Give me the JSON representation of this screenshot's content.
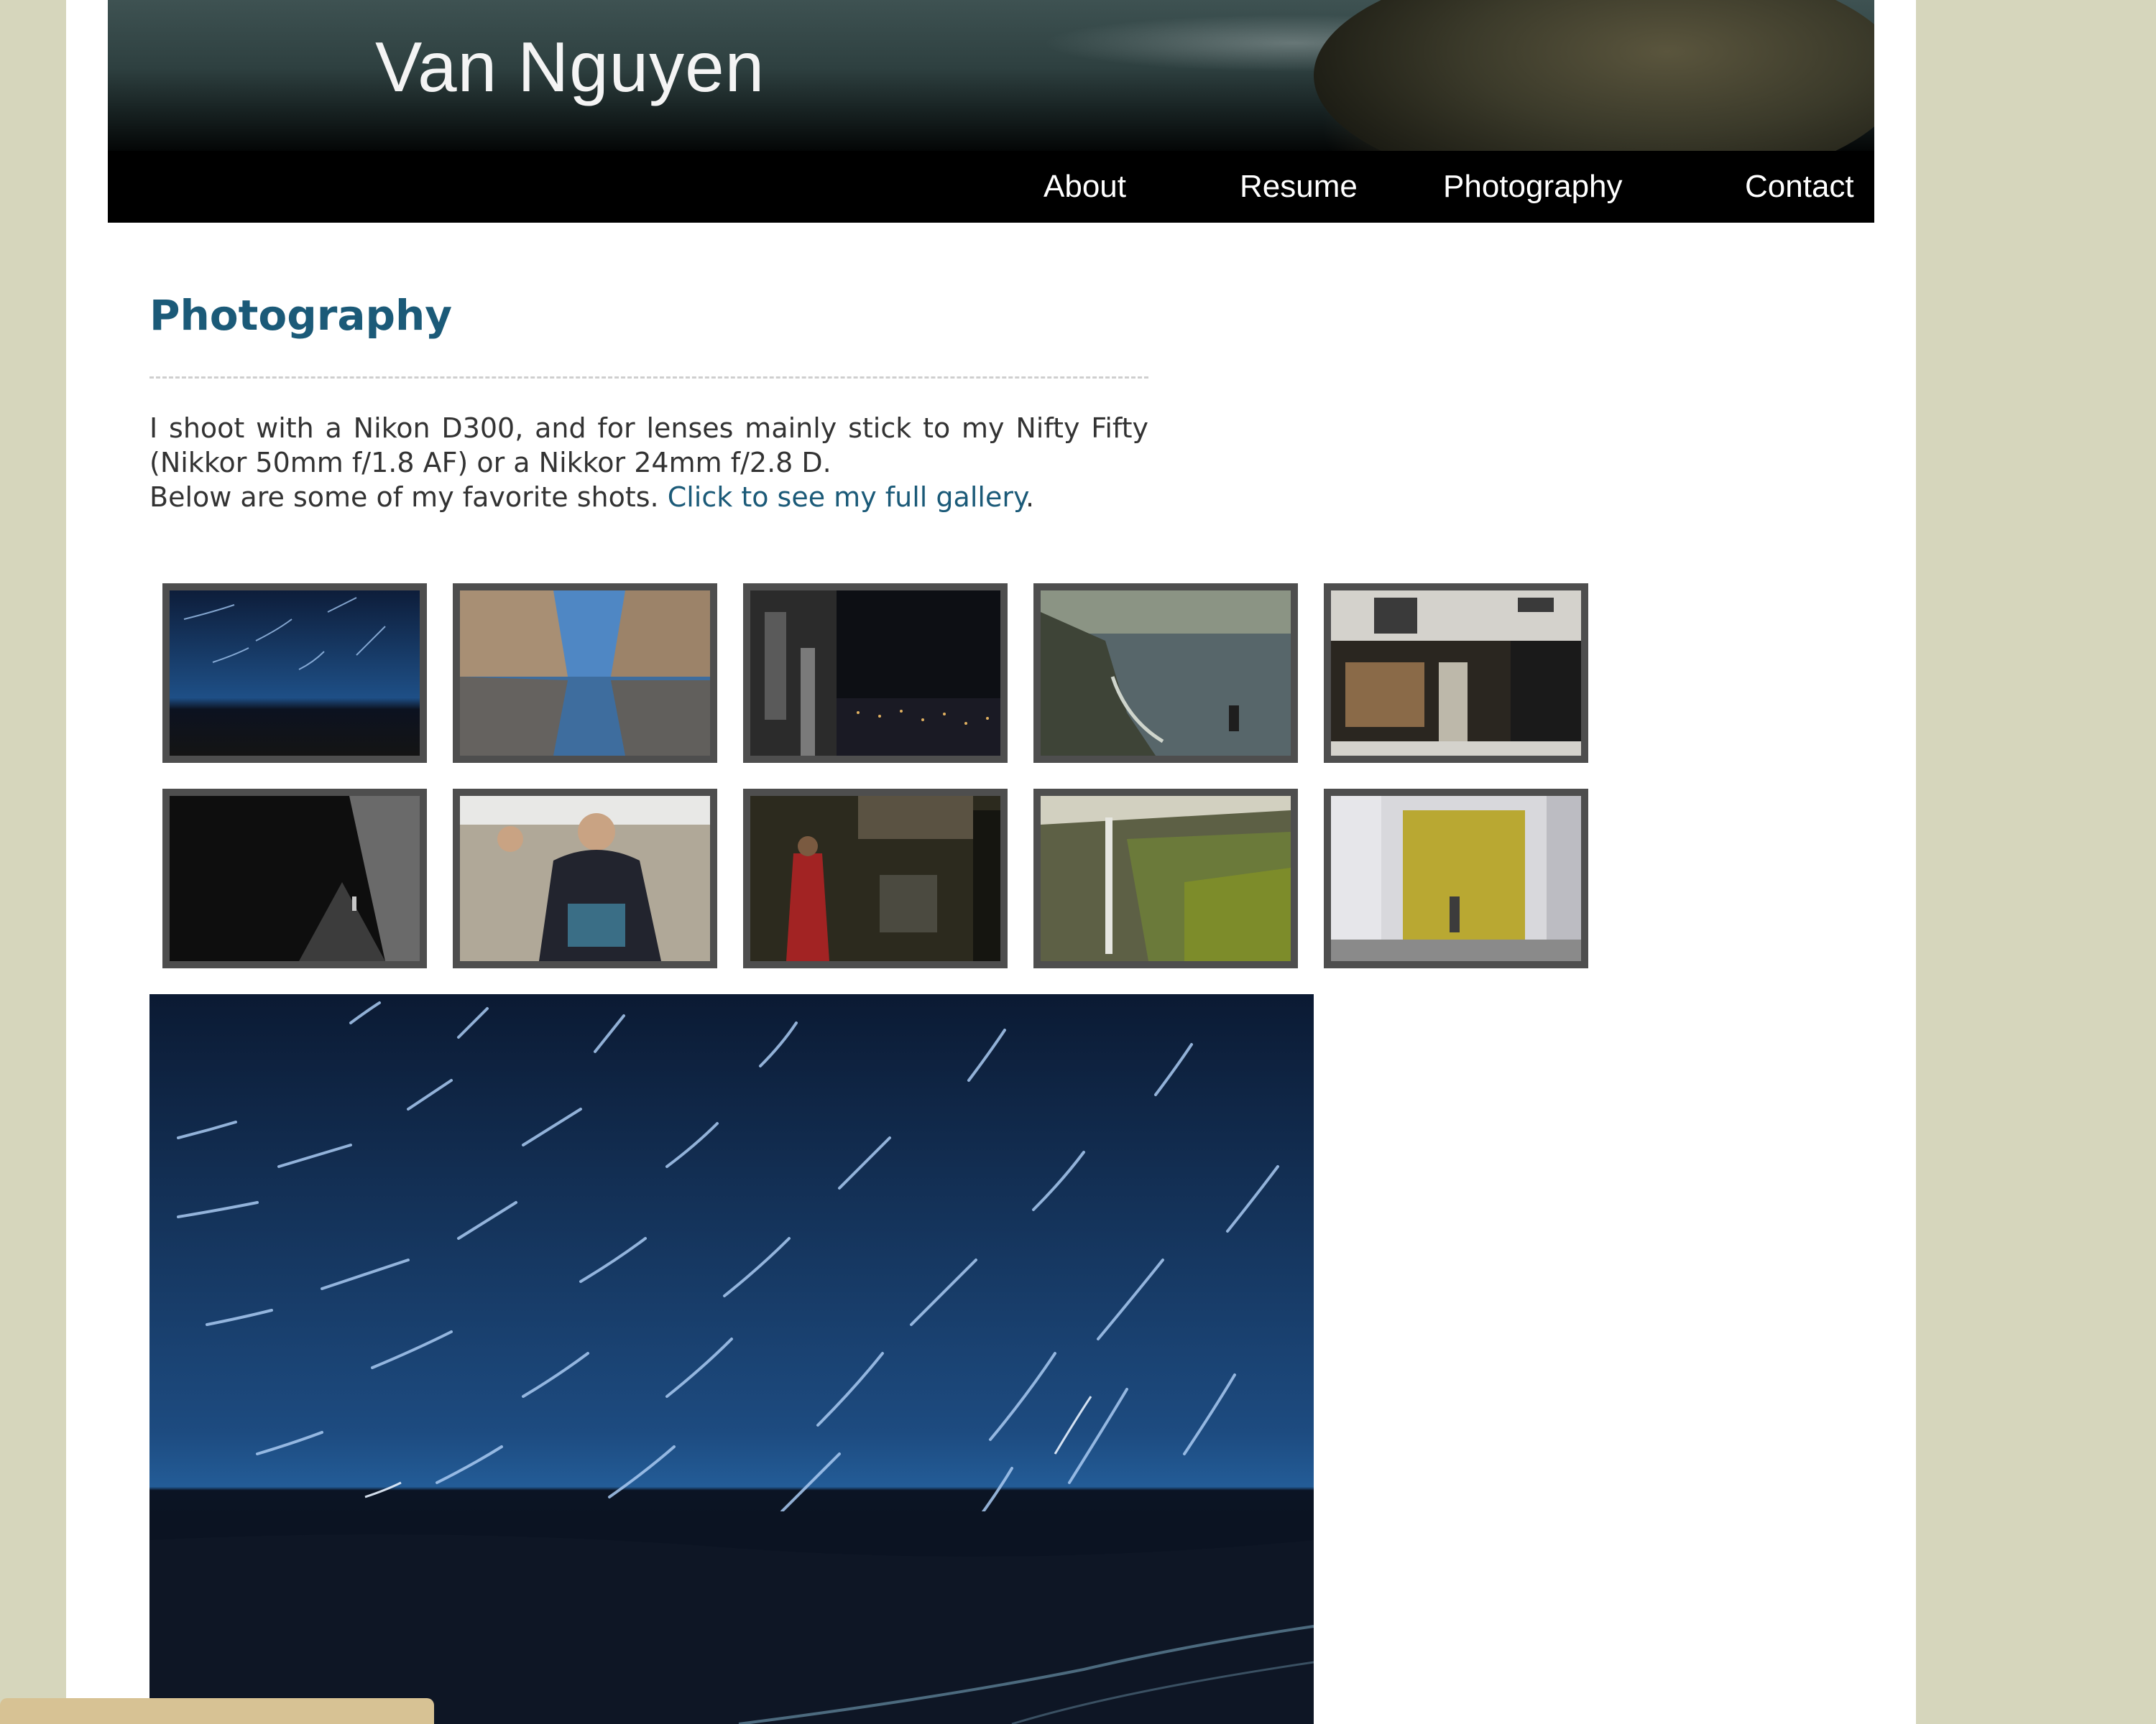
{
  "site": {
    "title": "Van Nguyen"
  },
  "nav": {
    "items": [
      {
        "label": "About"
      },
      {
        "label": "Resume"
      },
      {
        "label": "Photography"
      },
      {
        "label": "Contact"
      }
    ]
  },
  "main": {
    "heading": "Photography",
    "intro_line1": "I shoot with a Nikon D300, and for lenses mainly stick to my Nifty Fifty (Nikkor 50mm f/1.8 AF) or a Nikkor 24mm f/2.8 D.",
    "intro_line2_prefix": "Below are some of my favorite shots. ",
    "intro_link": "Click to see my full gallery",
    "intro_suffix": "."
  },
  "gallery": {
    "thumbnails": [
      {
        "icon": "star-trails-photo"
      },
      {
        "icon": "canyon-reflection-photo"
      },
      {
        "icon": "city-night-photo"
      },
      {
        "icon": "coastal-cliff-photo"
      },
      {
        "icon": "antiques-shop-photo"
      },
      {
        "icon": "dark-alley-photo"
      },
      {
        "icon": "waving-woman-photo"
      },
      {
        "icon": "market-scene-photo"
      },
      {
        "icon": "waterfall-photo"
      },
      {
        "icon": "gold-curtain-photo"
      }
    ],
    "selected": {
      "icon": "star-trails-large-photo"
    }
  },
  "colors": {
    "page_background": "#d6d6bc",
    "heading": "#1b5a78",
    "link": "#1b5a78",
    "thumb_border": "#4e4e4e"
  }
}
